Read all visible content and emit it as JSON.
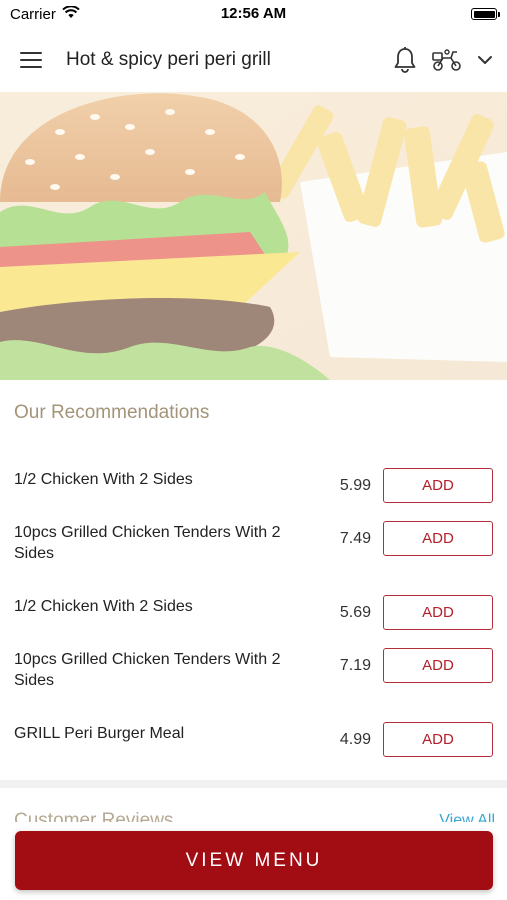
{
  "status_bar": {
    "carrier": "Carrier",
    "time": "12:56 AM"
  },
  "app_bar": {
    "title": "Hot & spicy peri peri grill"
  },
  "recommendations": {
    "title": "Our Recommendations",
    "items": [
      {
        "name": "1/2 Chicken With 2 Sides",
        "price": "5.99",
        "action": "ADD"
      },
      {
        "name": "10pcs Grilled Chicken Tenders With 2 Sides",
        "price": "7.49",
        "action": "ADD"
      },
      {
        "name": "1/2 Chicken With 2 Sides",
        "price": "5.69",
        "action": "ADD"
      },
      {
        "name": "10pcs Grilled Chicken Tenders With 2 Sides",
        "price": "7.19",
        "action": "ADD"
      },
      {
        "name": "GRILL Peri Burger Meal",
        "price": "4.99",
        "action": "ADD"
      }
    ]
  },
  "reviews": {
    "title": "Customer Reviews",
    "view_all": "View All"
  },
  "bottom": {
    "view_menu": "VIEW MENU"
  },
  "colors": {
    "accent": "#a20d14",
    "add_border": "#b3303a",
    "section_title": "#a39479",
    "link": "#3aa6cf"
  }
}
